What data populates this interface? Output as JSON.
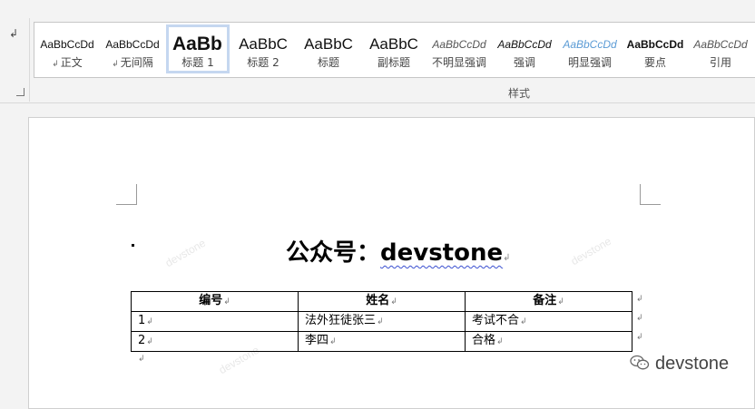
{
  "ribbon": {
    "para_mark_icon": "paragraph-mark-icon",
    "styles": [
      {
        "preview": "AaBbCcDd",
        "label": "正文",
        "has_mark": true,
        "kind": "normal"
      },
      {
        "preview": "AaBbCcDd",
        "label": "无间隔",
        "has_mark": true,
        "kind": "normal"
      },
      {
        "preview": "AaBb",
        "label": "标题 1",
        "has_mark": false,
        "kind": "h1",
        "selected": true
      },
      {
        "preview": "AaBbC",
        "label": "标题 2",
        "has_mark": false,
        "kind": "h2"
      },
      {
        "preview": "AaBbC",
        "label": "标题",
        "has_mark": false,
        "kind": "title"
      },
      {
        "preview": "AaBbC",
        "label": "副标题",
        "has_mark": false,
        "kind": "subtitle"
      },
      {
        "preview": "AaBbCcDd",
        "label": "不明显强调",
        "has_mark": false,
        "kind": "subtle"
      },
      {
        "preview": "AaBbCcDd",
        "label": "强调",
        "has_mark": false,
        "kind": "emph"
      },
      {
        "preview": "AaBbCcDd",
        "label": "明显强调",
        "has_mark": false,
        "kind": "intense"
      },
      {
        "preview": "AaBbCcDd",
        "label": "要点",
        "has_mark": false,
        "kind": "strong"
      },
      {
        "preview": "AaBbCcDd",
        "label": "引用",
        "has_mark": false,
        "kind": "quote"
      }
    ],
    "group_label": "样式",
    "colors": {
      "selected_border": "#c5d7f0",
      "intense_emphasis": "#5b9bd5"
    }
  },
  "document": {
    "title_prefix": "公众号：",
    "title_brand": "devstone",
    "table": {
      "headers": [
        "编号",
        "姓名",
        "备注"
      ],
      "rows": [
        [
          "1",
          "法外狂徒张三",
          "考试不合"
        ],
        [
          "2",
          "李四",
          "合格"
        ]
      ]
    },
    "watermark_text": "devstone"
  },
  "overlay": {
    "brand": "devstone",
    "icon": "wechat-icon"
  }
}
